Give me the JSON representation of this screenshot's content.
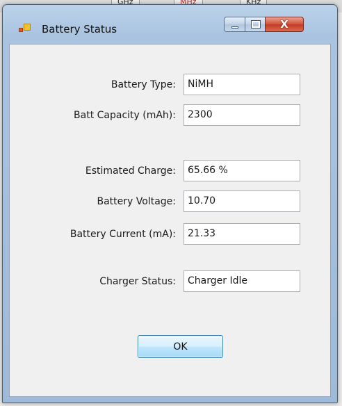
{
  "background_tabs": [
    "GHz",
    "MHz",
    "KHz"
  ],
  "window": {
    "title": "Battery Status",
    "icon": "app-window-icon",
    "controls": {
      "minimize_icon": "minimize-icon",
      "maximize_icon": "maximize-icon",
      "close_label": "X"
    }
  },
  "fields": {
    "battery_type": {
      "label": "Battery Type:",
      "value": "NiMH"
    },
    "batt_capacity": {
      "label": "Batt Capacity (mAh):",
      "value": "2300"
    },
    "estimated_charge": {
      "label": "Estimated Charge:",
      "value": "65.66 %"
    },
    "battery_voltage": {
      "label": "Battery Voltage:",
      "value": "10.70"
    },
    "battery_current": {
      "label": "Battery Current (mA):",
      "value": "21.33"
    },
    "charger_status": {
      "label": "Charger Status:",
      "value": "Charger Idle"
    }
  },
  "ok_label": "OK"
}
